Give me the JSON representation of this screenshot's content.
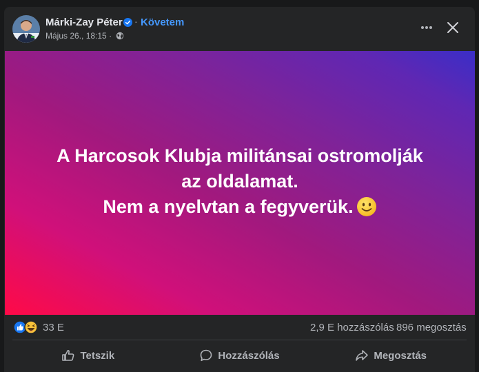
{
  "post": {
    "author": "Márki-Zay Péter",
    "follow_label": "Követem",
    "separator": "·",
    "timestamp": "Május 26., 18:15",
    "meta_separator": "·",
    "audience_icon": "globe-icon",
    "verified_icon": "verified-badge-icon",
    "banner": {
      "line1": "A Harcosok Klubja militánsai ostromolják",
      "line2": "az oldalamat.",
      "line3": "Nem a nyelvtan a fegyverük.",
      "emoji": "slightly-smiling-face-emoji"
    }
  },
  "stats": {
    "reaction_icons": [
      "like-reaction-icon",
      "haha-reaction-icon"
    ],
    "reaction_count": "33 E",
    "comments": "2,9 E hozzászólás",
    "shares": "896 megosztás"
  },
  "actions": {
    "like": "Tetszik",
    "comment": "Hozzászólás",
    "share": "Megosztás"
  },
  "colors": {
    "background": "#242526",
    "text": "#e4e6eb",
    "secondary_text": "#b0b3b8",
    "link": "#4599ff",
    "verified": "#1877f2",
    "banner_gradient": [
      "#ff0a47",
      "#a1197e",
      "#3a2ec7"
    ]
  }
}
